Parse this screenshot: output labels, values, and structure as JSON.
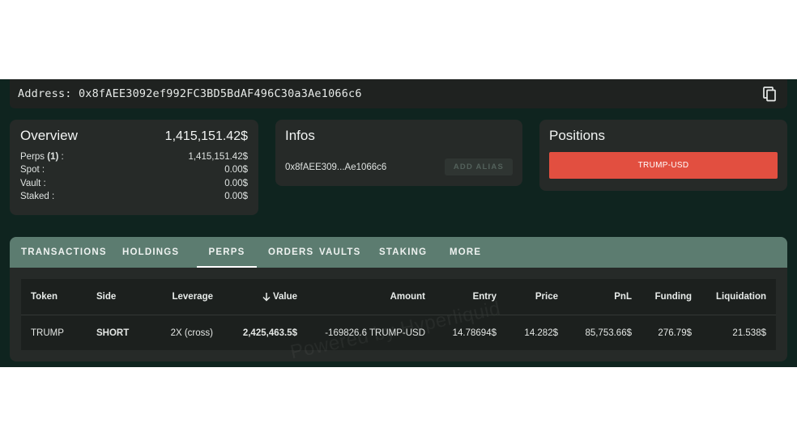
{
  "address_bar": {
    "text": "Address: 0x8fAEE3092ef992FC3BD5BdAF496C30a3Ae1066c6",
    "copy_icon": "copy-icon"
  },
  "overview": {
    "title": "Overview",
    "total": "1,415,151.42$",
    "rows": [
      {
        "label_prefix": "Perps ",
        "label_bold": "(1)",
        "label_suffix": " :",
        "value": "1,415,151.42$"
      },
      {
        "label_prefix": "Spot :",
        "value": "0.00$"
      },
      {
        "label_prefix": "Vault :",
        "value": "0.00$"
      },
      {
        "label_prefix": "Staked :",
        "value": "0.00$"
      }
    ]
  },
  "infos": {
    "title": "Infos",
    "address_short": "0x8fAEE309...Ae1066c6",
    "alias_button": "ADD ALIAS"
  },
  "positions": {
    "title": "Positions",
    "items": [
      "TRUMP-USD"
    ]
  },
  "tabs": [
    {
      "label": "TRANSACTIONS",
      "active": false
    },
    {
      "label": "HOLDINGS",
      "active": false
    },
    {
      "label": "PERPS",
      "active": true
    },
    {
      "label": "ORDERS",
      "active": false
    },
    {
      "label": "VAULTS",
      "active": false
    },
    {
      "label": "STAKING",
      "active": false
    },
    {
      "label": "MORE",
      "active": false
    }
  ],
  "table": {
    "headers": {
      "token": "Token",
      "side": "Side",
      "leverage": "Leverage",
      "value": "Value",
      "amount": "Amount",
      "entry": "Entry",
      "price": "Price",
      "pnl": "PnL",
      "funding": "Funding",
      "liquidation": "Liquidation"
    },
    "sort_icon": "arrow-down-icon",
    "rows": [
      {
        "token": "TRUMP",
        "side": "SHORT",
        "leverage": "2X (cross)",
        "value": "2,425,463.5$",
        "amount": "-169826.6 TRUMP-USD",
        "entry": "14.78694$",
        "price": "14.282$",
        "pnl": "85,753.66$",
        "funding": "276.79$",
        "liquidation": "21.538$"
      }
    ]
  },
  "watermark": "Powered by Hyperliquid",
  "colors": {
    "background": "#0f241f",
    "card": "#262a28",
    "tabbar": "#5c7c70",
    "short": "#e24a3c",
    "positive": "#3f9a45",
    "position_button": "#e24f40"
  }
}
